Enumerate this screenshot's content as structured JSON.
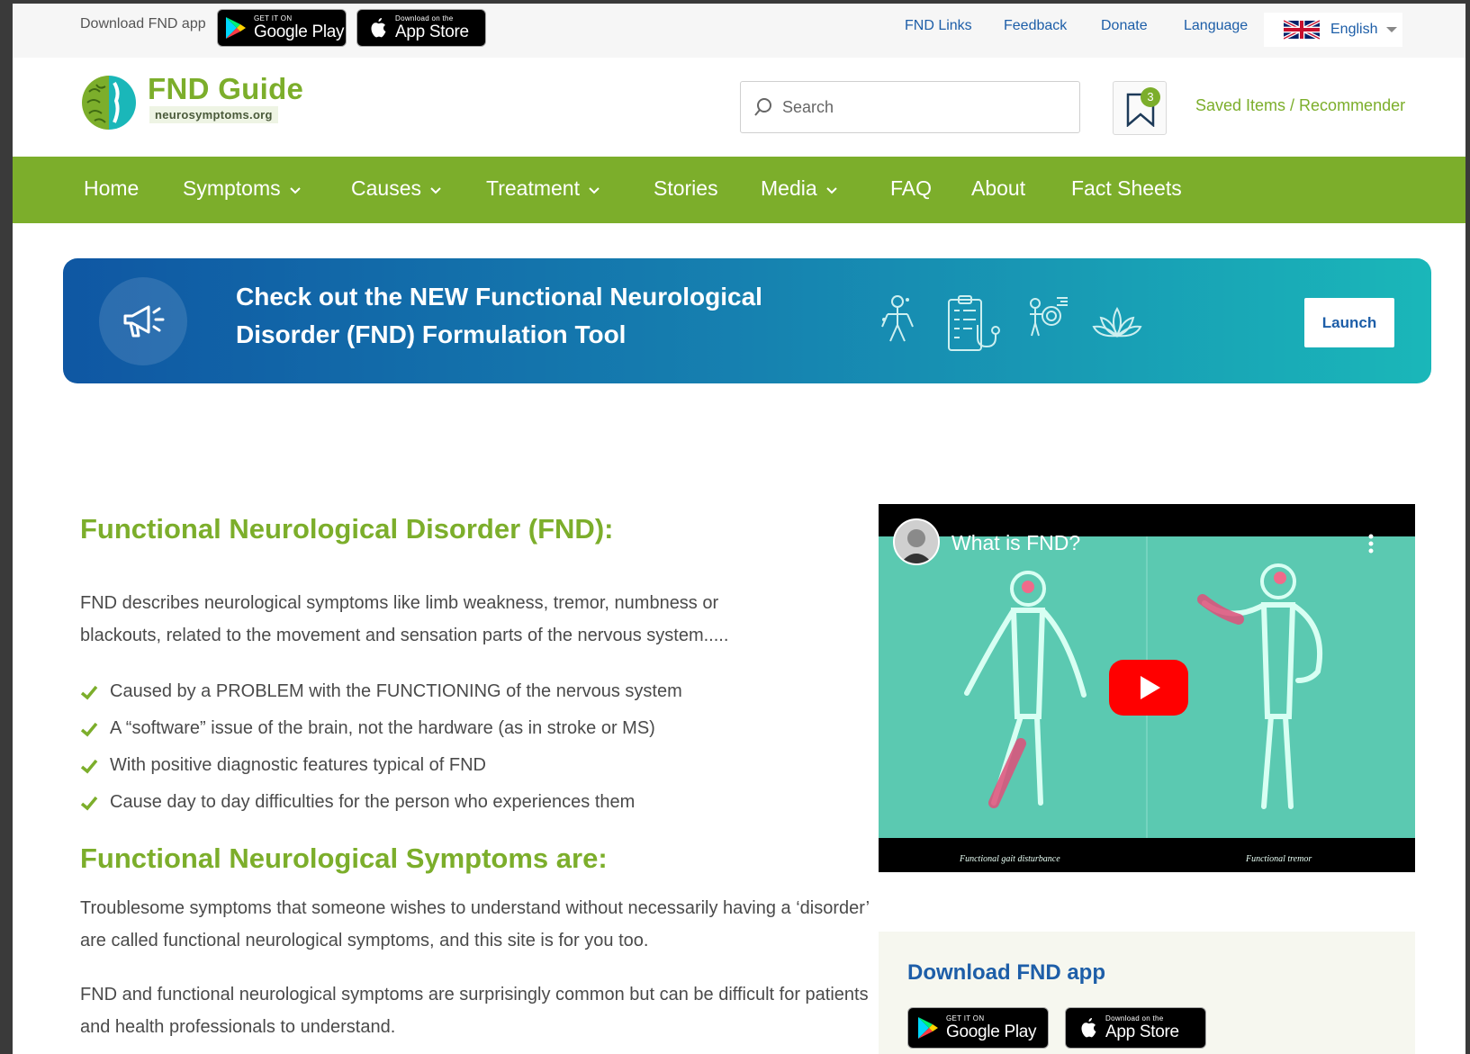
{
  "topbar": {
    "download_label": "Download FND app",
    "google_play_small": "GET IT ON",
    "google_play_big": "Google Play",
    "app_store_small": "Download on the",
    "app_store_big": "App Store",
    "links": [
      "FND Links",
      "Feedback",
      "Donate",
      "Language"
    ],
    "language_selected": "English"
  },
  "header": {
    "brand_name": "FND Guide",
    "brand_domain": "neurosymptoms.org",
    "search_placeholder": "Search",
    "saved_count": "3",
    "saved_link": "Saved Items / Recommender"
  },
  "nav": {
    "items": [
      "Home",
      "Symptoms",
      "Causes",
      "Treatment",
      "Stories",
      "Media",
      "FAQ",
      "About",
      "Fact Sheets"
    ]
  },
  "banner": {
    "title": "Check out the NEW Functional Neurological Disorder (FND) Formulation Tool",
    "launch_label": "Launch"
  },
  "content": {
    "heading1": "Functional Neurological Disorder (FND):",
    "intro": "FND describes neurological symptoms like limb weakness, tremor, numbness or blackouts, related to the movement and sensation parts of the nervous system.....",
    "checklist": [
      "Caused by a PROBLEM with the FUNCTIONING of the nervous system",
      "A “software” issue of the brain, not the hardware (as in stroke or MS)",
      "With positive diagnostic features typical of FND",
      "Cause day to day difficulties for the person who experiences them"
    ],
    "heading2": "Functional Neurological Symptoms are:",
    "para2": "Troublesome symptoms that someone wishes to understand without necessarily having a ‘disorder’ are called functional neurological symptoms, and this site is for you too.",
    "para3": "FND and functional neurological symptoms are surprisingly common but can be difficult for patients and health professionals to understand."
  },
  "video": {
    "title": "What is FND?",
    "caption_left": "Functional gait disturbance",
    "caption_right": "Functional tremor"
  },
  "appbox": {
    "title": "Download FND app",
    "google_play_small": "GET IT ON",
    "google_play_big": "Google Play",
    "app_store_small": "Download on the",
    "app_store_big": "App Store"
  },
  "colors": {
    "brand_green": "#7cae2b",
    "link_blue": "#1d5ea8",
    "banner_start": "#0f57a3",
    "banner_end": "#1ab7b9",
    "video_bg": "#5bc9b1",
    "youtube_red": "#ff0000"
  }
}
